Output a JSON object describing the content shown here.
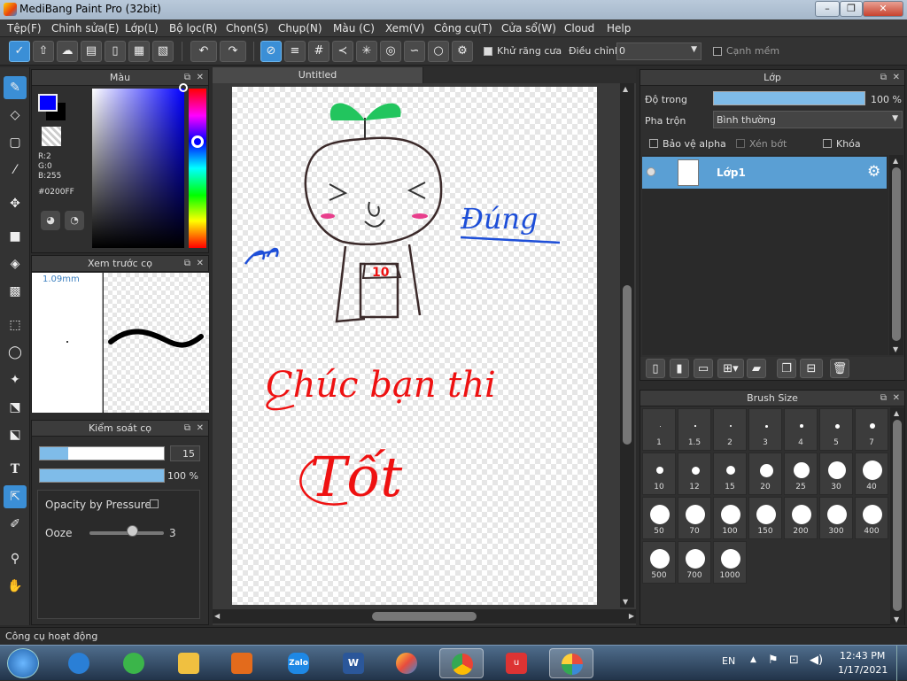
{
  "window": {
    "title": "MediBang Paint Pro (32bit)",
    "min": "–",
    "max": "❐",
    "close": "✕"
  },
  "menu": [
    "Tệp(F)",
    "Chỉnh sửa(E)",
    "Lớp(L)",
    "Bộ lọc(R)",
    "Chọn(S)",
    "Chụp(N)",
    "Màu (C)",
    "Xem(V)",
    "Công cụ(T)",
    "Cửa sổ(W)",
    "Cloud",
    "Help"
  ],
  "toolbar": {
    "antialias_label": "Khử răng cưa",
    "correction_label": "Điều chỉnh",
    "correction_value": "0",
    "soft_edge_label": "Cạnh mềm"
  },
  "color_panel": {
    "title": "Màu",
    "r": "R:2",
    "g": "G:0",
    "b": "B:255",
    "hex": "#0200FF",
    "fg": "#0200FF",
    "bg": "#000000"
  },
  "preview_panel": {
    "title": "Xem trước cọ",
    "size": "1.09mm"
  },
  "control_panel": {
    "title": "Kiểm soát cọ",
    "size_value": "15",
    "size_fraction": 0.23,
    "opacity_value": "100 %",
    "opacity_fraction": 1.0,
    "opacity_pressure_label": "Opacity by Pressure",
    "ooze_label": "Ooze",
    "ooze_value": "3"
  },
  "canvas": {
    "tab_title": "Untitled"
  },
  "layer_panel": {
    "title": "Lớp",
    "opacity_label": "Độ trong",
    "opacity_value": "100 %",
    "blend_label": "Pha trộn",
    "blend_value": "Bình thường",
    "protect_alpha": "Bảo vệ alpha",
    "clipping": "Xén bớt",
    "lock": "Khóa",
    "layers": [
      {
        "name": "Lớp1"
      }
    ]
  },
  "brush_size_panel": {
    "title": "Brush Size",
    "sizes": [
      "1",
      "1.5",
      "2",
      "3",
      "4",
      "5",
      "7",
      "10",
      "12",
      "15",
      "20",
      "25",
      "30",
      "40",
      "50",
      "70",
      "100",
      "150",
      "200",
      "300",
      "400",
      "500",
      "700",
      "1000"
    ]
  },
  "status": {
    "text": "Công cụ hoạt động"
  },
  "taskbar": {
    "lang": "EN",
    "time": "12:43 PM",
    "date": "1/17/2021",
    "zalo": "Zalo"
  }
}
